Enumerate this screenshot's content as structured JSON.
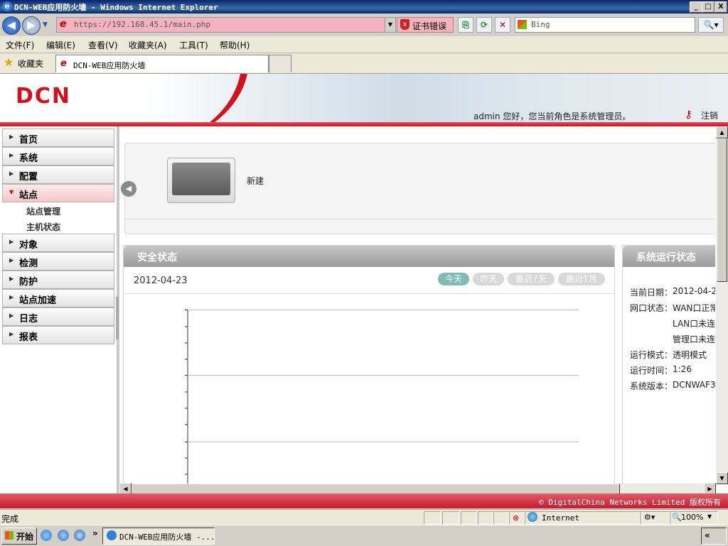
{
  "window": {
    "title": "DCN-WEB应用防火墙 - Windows Internet Explorer",
    "min": "_",
    "max": "□",
    "close": "X"
  },
  "navbar": {
    "url": "https://192.168.45.1/main.php",
    "cert_error": "证书错误",
    "search_placeholder": "Bing"
  },
  "menu": [
    "文件(F)",
    "编辑(E)",
    "查看(V)",
    "收藏夹(A)",
    "工具(T)",
    "帮助(H)"
  ],
  "favorites": {
    "label": "收藏夹",
    "tab_title": "DCN-WEB应用防火墙"
  },
  "header": {
    "logo": "DCN",
    "welcome": "admin 您好，您当前角色是系统管理员。",
    "logout": "注销"
  },
  "sidebar": {
    "items": [
      {
        "label": "首页"
      },
      {
        "label": "系统"
      },
      {
        "label": "配置"
      },
      {
        "label": "站点"
      },
      {
        "label": "对象"
      },
      {
        "label": "检测"
      },
      {
        "label": "防护"
      },
      {
        "label": "站点加速"
      },
      {
        "label": "日志"
      },
      {
        "label": "报表"
      }
    ],
    "subitems": [
      "站点管理",
      "主机状态"
    ]
  },
  "shortcut": {
    "new_label": "新建"
  },
  "security": {
    "title": "安全状态",
    "date": "2012-04-23",
    "filters": [
      "今天",
      "昨天",
      "最近7天",
      "最近1月"
    ]
  },
  "system": {
    "title": "系统运行状态",
    "date_label": "当前日期：",
    "date_value": "2012-04-2",
    "port_label": "网口状态：",
    "port_wan": "WAN口正常",
    "port_lan": "LAN口未连",
    "port_mgmt": "管理口未连",
    "mode_label": "运行模式：",
    "mode_value": "透明模式",
    "uptime_label": "运行时间：",
    "uptime_value": "1:26",
    "version_label": "系统版本：",
    "version_value": "DCNWAF3"
  },
  "footer": {
    "copyright": "© DigitalChina Networks Limited 版权所有"
  },
  "statusbar": {
    "status": "完成",
    "zone": "Internet",
    "zoom": "100%"
  },
  "taskbar": {
    "start": "开始",
    "window_item": "DCN-WEB应用防火墙 -..."
  },
  "colors": {
    "brand_red": "#d3101e",
    "pill_active": "#7fbcb6"
  }
}
